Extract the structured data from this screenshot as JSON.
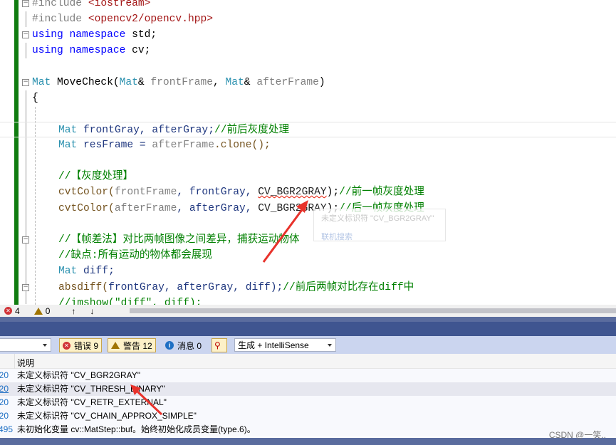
{
  "editor": {
    "lines": [
      {
        "fold": "minus",
        "tokens": [
          [
            "#include ",
            "pp"
          ],
          [
            "<iostream>",
            "str"
          ]
        ]
      },
      {
        "tokens": [
          [
            "#include ",
            "pp"
          ],
          [
            "<opencv2/opencv.hpp>",
            "str"
          ]
        ]
      },
      {
        "fold": "minus",
        "tokens": [
          [
            "using ",
            "kw"
          ],
          [
            "namespace ",
            "kw"
          ],
          [
            "std;",
            "plain"
          ]
        ]
      },
      {
        "tokens": [
          [
            "using ",
            "kw"
          ],
          [
            "namespace ",
            "kw"
          ],
          [
            "cv;",
            "plain"
          ]
        ]
      },
      {
        "tokens": []
      },
      {
        "fold": "minus",
        "tokens": [
          [
            "Mat",
            "type"
          ],
          [
            " MoveCheck(",
            "plain"
          ],
          [
            "Mat",
            "type"
          ],
          [
            "& ",
            "plain"
          ],
          [
            "frontFrame",
            "param"
          ],
          [
            ", ",
            "plain"
          ],
          [
            "Mat",
            "type"
          ],
          [
            "& ",
            "plain"
          ],
          [
            "afterFrame",
            "param"
          ],
          [
            ")",
            "plain"
          ]
        ]
      },
      {
        "tokens": [
          [
            "{",
            "plain"
          ]
        ],
        "indent": 0
      },
      {
        "tokens": []
      },
      {
        "current": true,
        "tokens": [
          [
            "Mat",
            "type"
          ],
          [
            " frontGray, afterGray;",
            "var"
          ],
          [
            "//前后灰度处理",
            "cm"
          ]
        ]
      },
      {
        "tokens": [
          [
            "Mat",
            "type"
          ],
          [
            " resFrame = ",
            "var"
          ],
          [
            "afterFrame",
            "param"
          ],
          [
            ".clone();",
            "fn"
          ]
        ]
      },
      {
        "tokens": []
      },
      {
        "tokens": [
          [
            "//【灰度处理】",
            "cm"
          ]
        ]
      },
      {
        "tokens": [
          [
            "cvtColor(",
            "fn"
          ],
          [
            "frontFrame",
            "param"
          ],
          [
            ", frontGray, ",
            "var"
          ],
          [
            "CV_BGR2GRAY",
            "macro",
            "squig"
          ],
          [
            ");",
            "plain"
          ],
          [
            "//前一帧灰度处理",
            "cm"
          ]
        ]
      },
      {
        "tokens": [
          [
            "cvtColor(",
            "fn"
          ],
          [
            "afterFrame",
            "param"
          ],
          [
            ", afterGray, ",
            "var"
          ],
          [
            "CV_BGR2GRAY",
            "macro"
          ],
          [
            ");",
            "plain"
          ],
          [
            "//后一帧灰度处理",
            "cm"
          ]
        ]
      },
      {
        "tokens": []
      },
      {
        "fold": "minus",
        "tokens": [
          [
            "//【帧差法】对比两帧图像之间差异，捕获运动物体",
            "cm"
          ]
        ]
      },
      {
        "tokens": [
          [
            "//缺点:所有运动的物体都会展现",
            "cm"
          ]
        ]
      },
      {
        "tokens": [
          [
            "Mat",
            "type"
          ],
          [
            " diff;",
            "var"
          ]
        ]
      },
      {
        "fold": "minus",
        "tokens": [
          [
            "absdiff(",
            "fn"
          ],
          [
            "frontGray, afterGray, diff);",
            "var"
          ],
          [
            "//前后两帧对比存在diff中",
            "cm"
          ]
        ]
      },
      {
        "tokens": [
          [
            "//imshow(\"diff\", diff);",
            "cm"
          ]
        ]
      }
    ],
    "tooltip": {
      "message": "未定义标识符 \"CV_BGR2GRAY\"",
      "link": "联机搜索"
    }
  },
  "statusbar": {
    "errors": "4",
    "warnings": "0",
    "up_icon": "↑",
    "down_icon": "↓"
  },
  "error_list": {
    "scope_value": "",
    "errors_label": "错误 9",
    "warnings_label": "警告 12",
    "messages_label": "消息 0",
    "source_filter": "生成 + IntelliSense",
    "column_description": "说明",
    "rows": [
      {
        "code": "20",
        "description": "未定义标识符 \"CV_BGR2GRAY\""
      },
      {
        "code": "20",
        "description": "未定义标识符 \"CV_THRESH_BINARY\""
      },
      {
        "code": "20",
        "description": "未定义标识符 \"CV_RETR_EXTERNAL\""
      },
      {
        "code": "20",
        "description": "未定义标识符 \"CV_CHAIN_APPROX_SIMPLE\""
      },
      {
        "code": "495",
        "description": "未初始化变量 cv::MatStep::buf。始终初始化成员变量(type.6)。"
      }
    ]
  },
  "watermark": "CSDN @一笑..",
  "colors": {
    "annotation_arrow": "#e8322b",
    "panel_title": "#3f5590",
    "toolbar": "#cbd5ef",
    "git_bar": "#107c10"
  }
}
